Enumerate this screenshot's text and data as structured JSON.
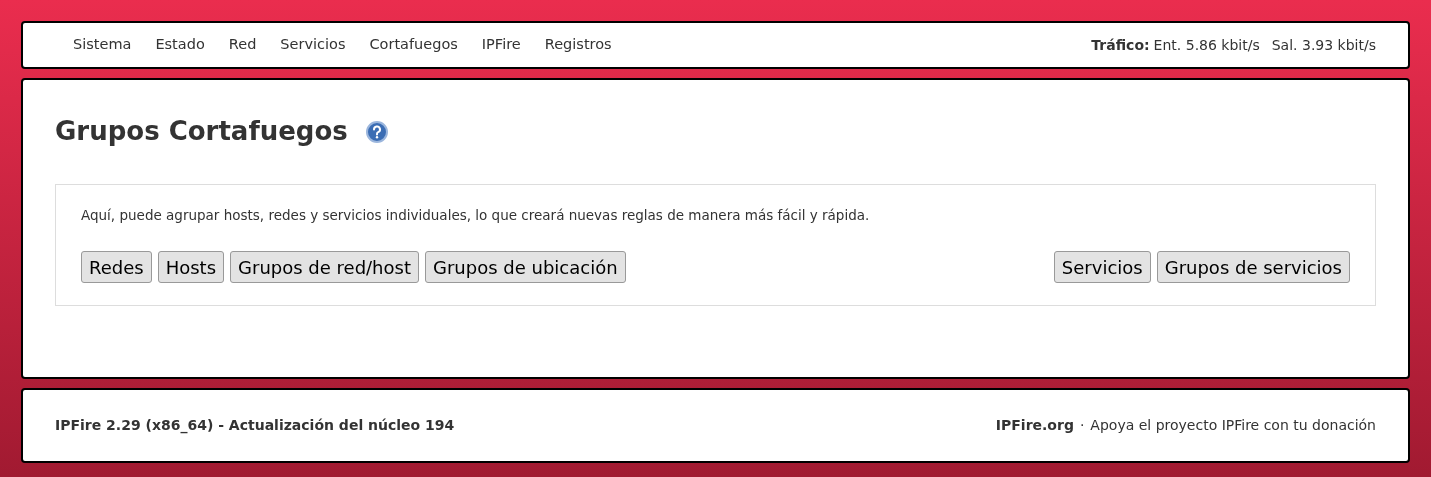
{
  "nav": {
    "items": [
      {
        "label": "Sistema"
      },
      {
        "label": "Estado"
      },
      {
        "label": "Red"
      },
      {
        "label": "Servicios"
      },
      {
        "label": "Cortafuegos"
      },
      {
        "label": "IPFire"
      },
      {
        "label": "Registros"
      }
    ],
    "traffic": {
      "label": "Tráfico:",
      "incoming": "Ent. 5.86 kbit/s",
      "outgoing": "Sal. 3.93 kbit/s"
    }
  },
  "page": {
    "title": "Grupos Cortafuegos",
    "description": "Aquí, puede agrupar hosts, redes y servicios individuales, lo que creará nuevas reglas de manera más fácil y rápida.",
    "buttons_left": [
      "Redes",
      "Hosts",
      "Grupos de red/host",
      "Grupos de ubicación"
    ],
    "buttons_right": [
      "Servicios",
      "Grupos de servicios"
    ]
  },
  "footer": {
    "version": "IPFire 2.29 (x86_64) - Actualización del núcleo 194",
    "link": "IPFire.org",
    "separator": "·",
    "donate": "Apoya el proyecto IPFire con tu donación"
  }
}
